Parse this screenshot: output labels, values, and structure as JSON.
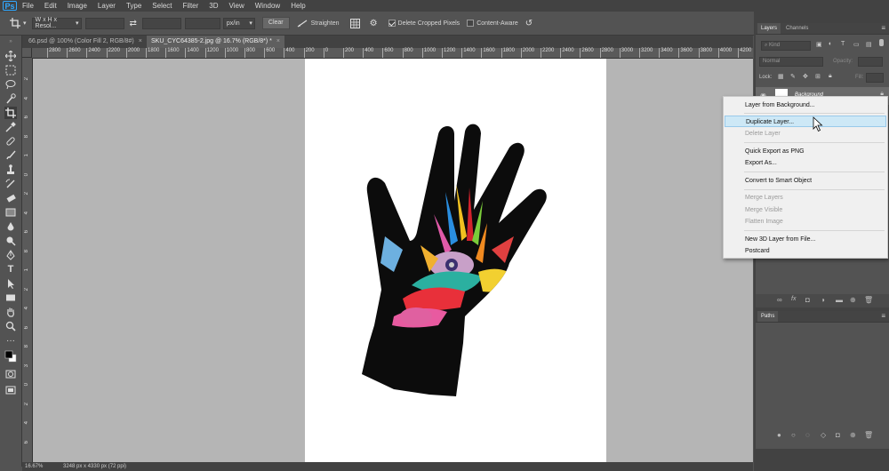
{
  "menubar": {
    "logo": "Ps",
    "items": [
      "File",
      "Edit",
      "Image",
      "Layer",
      "Type",
      "Select",
      "Filter",
      "3D",
      "View",
      "Window",
      "Help"
    ]
  },
  "options": {
    "ratio_preset": "W x H x Resol...",
    "unit_select": "px/in",
    "clear_label": "Clear",
    "straighten_label": "Straighten",
    "delete_cropped_label": "Delete Cropped Pixels",
    "delete_cropped_checked": true,
    "content_aware_label": "Content-Aware",
    "content_aware_checked": false
  },
  "tabs": [
    {
      "label": "66.psd @ 100% (Color Fill 2, RGB/8#)",
      "close": "×",
      "active": false
    },
    {
      "label": "SKU_CYC64385-2.jpg @ 16.7% (RGB/8*) *",
      "close": "×",
      "active": true
    }
  ],
  "ruler_top": [
    "2800",
    "2600",
    "2400",
    "2200",
    "2000",
    "1800",
    "1600",
    "1400",
    "1200",
    "1000",
    "800",
    "600",
    "400",
    "200",
    "0",
    "200",
    "400",
    "600",
    "800",
    "1000",
    "1200",
    "1400",
    "1600",
    "1800",
    "2000",
    "2200",
    "2400",
    "2600",
    "2800",
    "3000",
    "3200",
    "3400",
    "3600",
    "3800",
    "4000",
    "4200",
    "4400"
  ],
  "ruler_left": [
    "2",
    "4",
    "6",
    "8",
    "1",
    "0",
    "2",
    "4",
    "6",
    "8",
    "1",
    "2",
    "4",
    "6",
    "8",
    "3",
    "0",
    "2",
    "4",
    "6",
    "8"
  ],
  "status": {
    "zoom": "16.67%",
    "doc_size": "3248 px x 4330 px (72 ppi)"
  },
  "layers_panel": {
    "tabs": [
      "Layers",
      "Channels"
    ],
    "kind_label": "Kind",
    "blend_mode": "Normal",
    "opacity_label": "Opacity:",
    "lock_label": "Lock:",
    "fill_label": "Fill:",
    "layer_name": "Background"
  },
  "paths_panel": {
    "title": "Paths"
  },
  "context_menu": {
    "items": [
      {
        "label": "Layer from Background...",
        "disabled": false,
        "highlight": false
      },
      {
        "label": "Duplicate Layer...",
        "disabled": false,
        "highlight": true
      },
      {
        "label": "Delete Layer",
        "disabled": true,
        "highlight": false
      },
      {
        "label": "Quick Export as PNG",
        "disabled": false,
        "highlight": false
      },
      {
        "label": "Export As...",
        "disabled": false,
        "highlight": false
      },
      {
        "label": "Convert to Smart Object",
        "disabled": false,
        "highlight": false
      },
      {
        "label": "Merge Layers",
        "disabled": true,
        "highlight": false
      },
      {
        "label": "Merge Visible",
        "disabled": true,
        "highlight": false
      },
      {
        "label": "Flatten Image",
        "disabled": true,
        "highlight": false
      },
      {
        "label": "New 3D Layer from File...",
        "disabled": false,
        "highlight": false
      },
      {
        "label": "Postcard",
        "disabled": false,
        "highlight": false
      }
    ]
  },
  "colors": {
    "ps_blue": "#31a8ff",
    "menu_highlight": "#cde8f6",
    "canvas_bg": "#b5b5b5"
  }
}
